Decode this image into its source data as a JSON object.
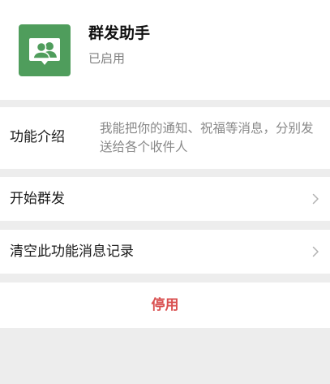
{
  "app": {
    "name": "群发助手",
    "status": "已启用",
    "icon": "group-chat-icon",
    "icon_color": "#4f9d5c"
  },
  "intro": {
    "label": "功能介绍",
    "text": "我能把你的通知、祝福等消息，分别发送给各个收件人"
  },
  "actions": {
    "start_label": "开始群发",
    "clear_label": "清空此功能消息记录",
    "disable_label": "停用",
    "disable_color": "#d94f4f"
  }
}
